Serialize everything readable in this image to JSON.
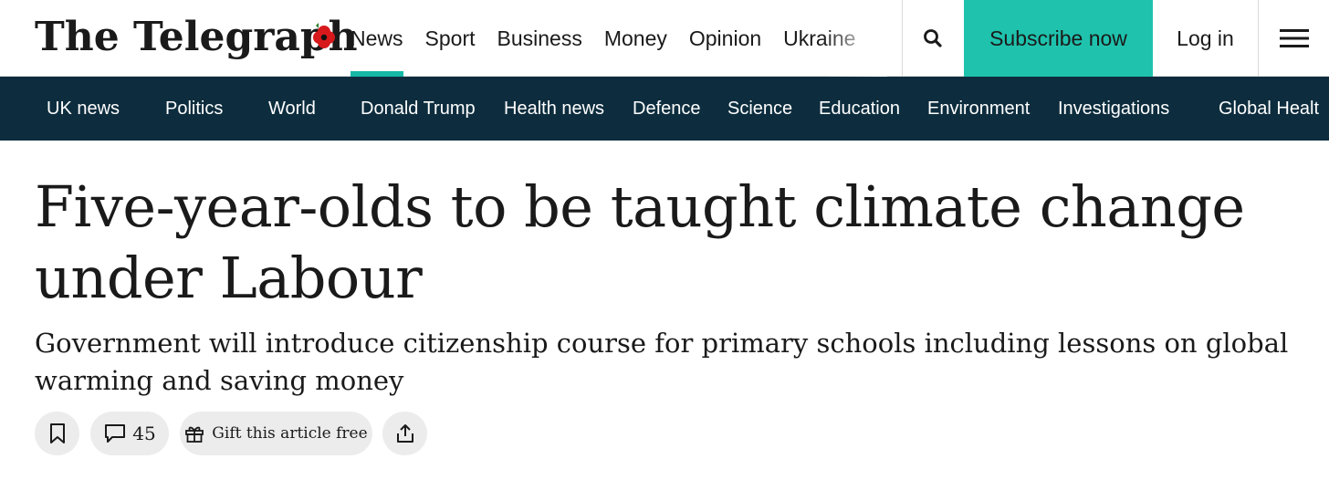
{
  "header": {
    "logo_text": "The Telegraph",
    "main_nav": [
      {
        "label": "News",
        "active": true
      },
      {
        "label": "Sport",
        "active": false
      },
      {
        "label": "Business",
        "active": false
      },
      {
        "label": "Money",
        "active": false
      },
      {
        "label": "Opinion",
        "active": false
      },
      {
        "label": "Ukraine",
        "active": false
      }
    ],
    "search_icon": "search-icon",
    "subscribe_label": "Subscribe now",
    "login_label": "Log in",
    "menu_icon": "hamburger-menu-icon"
  },
  "section_nav": {
    "items": [
      "UK news",
      "Politics",
      "World",
      "Donald Trump",
      "Health news",
      "Defence",
      "Science",
      "Education",
      "Environment",
      "Investigations",
      "Global Healt"
    ]
  },
  "article": {
    "headline": "Five-year-olds to be taught climate change under Labour",
    "standfirst": "Government will introduce citizenship course for primary schools including lessons on global warming and saving money",
    "comment_count": "45",
    "gift_label": "Gift this article free"
  },
  "colors": {
    "accent_teal": "#1fc2ad",
    "nav_underline": "#16b8a6",
    "section_nav_bg": "#0d2d3e",
    "poppy_red": "#d7191c",
    "pill_bg": "#ececec"
  }
}
